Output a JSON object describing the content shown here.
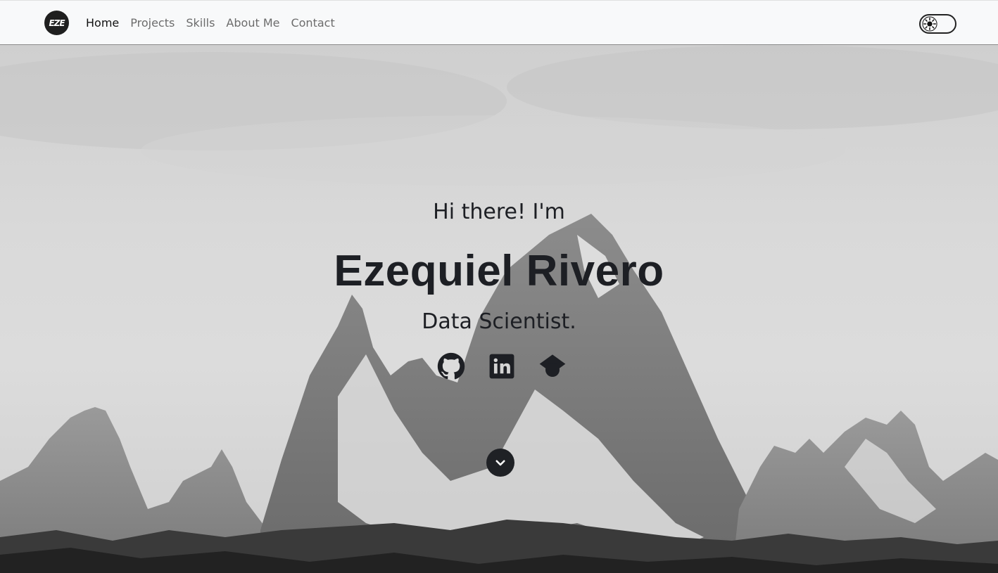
{
  "navbar": {
    "logo_text": "EZE",
    "links": [
      {
        "label": "Home",
        "active": true
      },
      {
        "label": "Projects",
        "active": false
      },
      {
        "label": "Skills",
        "active": false
      },
      {
        "label": "About Me",
        "active": false
      },
      {
        "label": "Contact",
        "active": false
      }
    ],
    "theme_toggle_icon": "sun-icon"
  },
  "hero": {
    "greeting": "Hi there! I'm",
    "name": "Ezequiel Rivero",
    "role": "Data Scientist.",
    "socials": [
      {
        "icon": "github-icon"
      },
      {
        "icon": "linkedin-icon"
      },
      {
        "icon": "graduation-cap-icon"
      }
    ],
    "scroll_icon": "chevron-down-icon"
  },
  "colors": {
    "navbar_bg": "#f8f9fa",
    "text_dark": "#1d1f24",
    "nav_inactive": "#6c6c6c"
  }
}
